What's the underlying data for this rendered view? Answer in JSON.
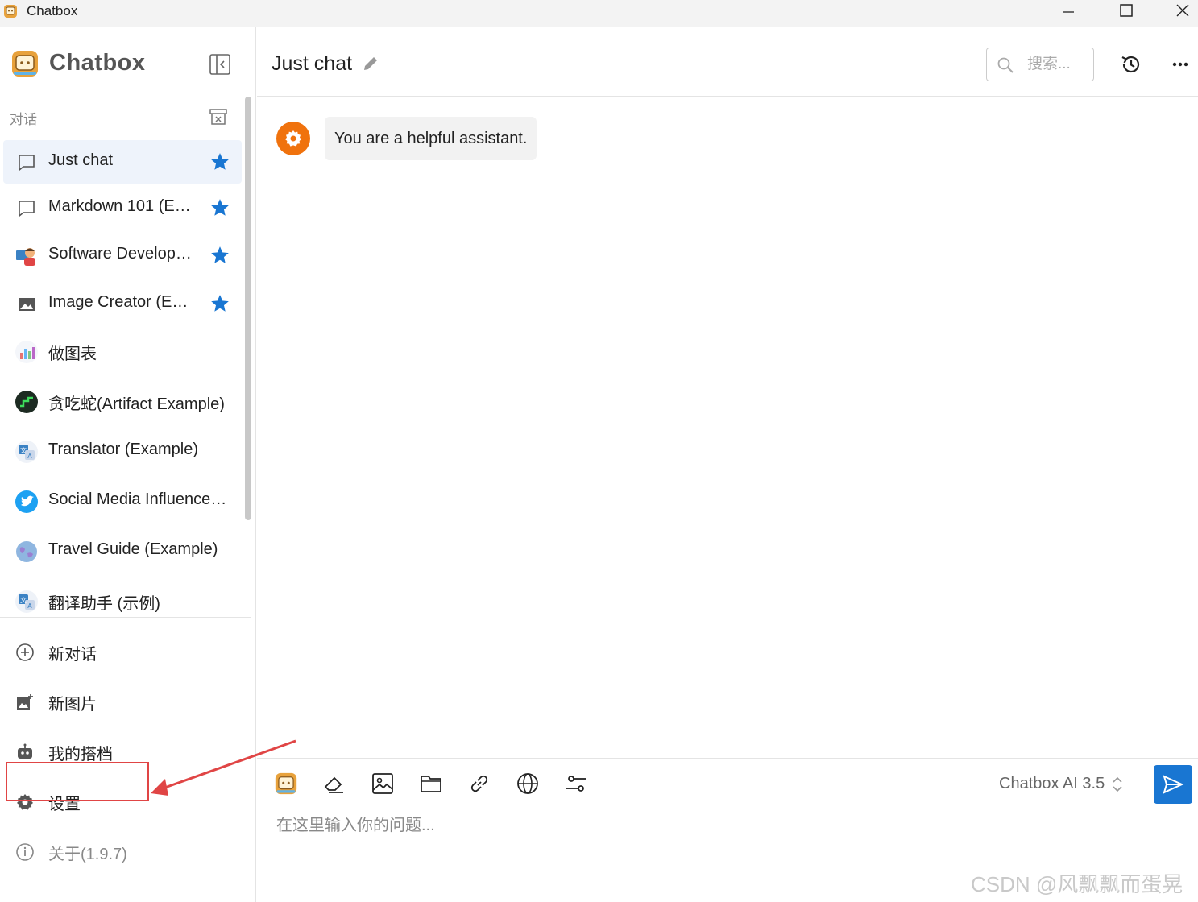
{
  "window": {
    "title": "Chatbox"
  },
  "sidebar": {
    "brand": "Chatbox",
    "section_label": "对话",
    "sessions": [
      {
        "label": "Just chat",
        "icon": "chat-bubble-icon",
        "starred": true,
        "active": true
      },
      {
        "label": "Markdown 101 (E…",
        "icon": "chat-bubble-icon",
        "starred": true,
        "active": false
      },
      {
        "label": "Software Develop…",
        "icon": "developer-avatar-icon",
        "starred": true,
        "active": false
      },
      {
        "label": "Image Creator (E…",
        "icon": "image-icon",
        "starred": true,
        "active": false
      },
      {
        "label": "做图表",
        "icon": "chart-avatar-icon",
        "starred": false,
        "active": false
      },
      {
        "label": "贪吃蛇(Artifact Example)",
        "icon": "snake-avatar-icon",
        "starred": false,
        "active": false
      },
      {
        "label": "Translator (Example)",
        "icon": "translate-avatar-icon",
        "starred": false,
        "active": false
      },
      {
        "label": "Social Media Influence…",
        "icon": "twitter-avatar-icon",
        "starred": false,
        "active": false
      },
      {
        "label": "Travel Guide (Example)",
        "icon": "globe-avatar-icon",
        "starred": false,
        "active": false
      },
      {
        "label": "翻译助手 (示例)",
        "icon": "translate-avatar-icon",
        "starred": false,
        "active": false
      }
    ],
    "nav": {
      "new_chat": "新对话",
      "new_image": "新图片",
      "my_copilots": "我的搭档",
      "settings": "设置",
      "about": "关于(1.9.7)"
    }
  },
  "header": {
    "title": "Just chat",
    "search_placeholder": "搜索..."
  },
  "messages": [
    {
      "role": "system",
      "text": "You are a helpful assistant."
    }
  ],
  "input": {
    "model": "Chatbox AI 3.5",
    "placeholder": "在这里输入你的问题..."
  },
  "colors": {
    "accent": "#1976d2",
    "star": "#1976d2",
    "system_avatar": "#f0720d",
    "highlight_annotation": "#e04545"
  },
  "watermark": "CSDN @风飘飘而蛋晃"
}
